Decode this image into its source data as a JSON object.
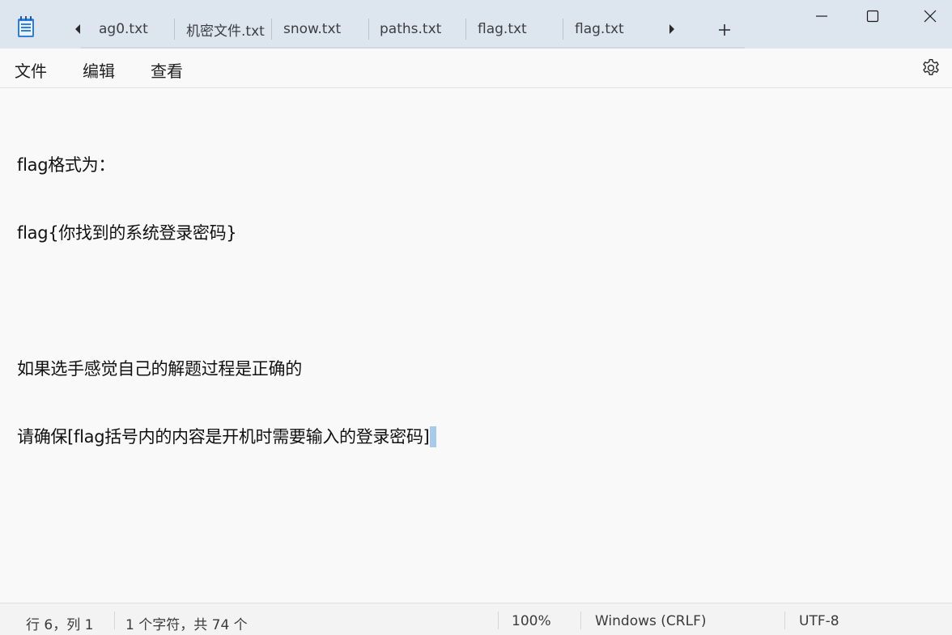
{
  "titlebar": {
    "tabs": [
      {
        "label": "ag0.txt"
      },
      {
        "label": "机密文件.txt"
      },
      {
        "label": "snow.txt"
      },
      {
        "label": "paths.txt"
      },
      {
        "label": "flag.txt"
      },
      {
        "label": "flag.txt"
      }
    ],
    "icons": {
      "app": "notepad-icon",
      "scroll_left": "caret-left-icon",
      "scroll_right": "caret-right-icon",
      "new_tab": "plus-icon",
      "minimize": "minimize-icon",
      "maximize": "maximize-icon",
      "close": "close-icon"
    }
  },
  "menu": {
    "file": "文件",
    "edit": "编辑",
    "view": "查看",
    "settings_icon": "gear-icon"
  },
  "editor": {
    "lines": [
      "flag格式为：",
      "flag{你找到的系统登录密码}",
      "",
      "如果选手感觉自己的解题过程是正确的",
      "请确保[flag括号内的内容是开机时需要输入的登录密码]"
    ]
  },
  "status": {
    "position": "行 6，列 1",
    "chars": "1 个字符，共 74 个",
    "zoom": "100%",
    "line_ending": "Windows (CRLF)",
    "encoding": "UTF-8"
  },
  "colors": {
    "titlebar_bg": "#dde6ee",
    "editor_bg": "#f9f9f9",
    "statusbar_bg": "#f3f3f3",
    "selection": "#a8c8ee",
    "app_icon_blue": "#2f7fd8"
  }
}
